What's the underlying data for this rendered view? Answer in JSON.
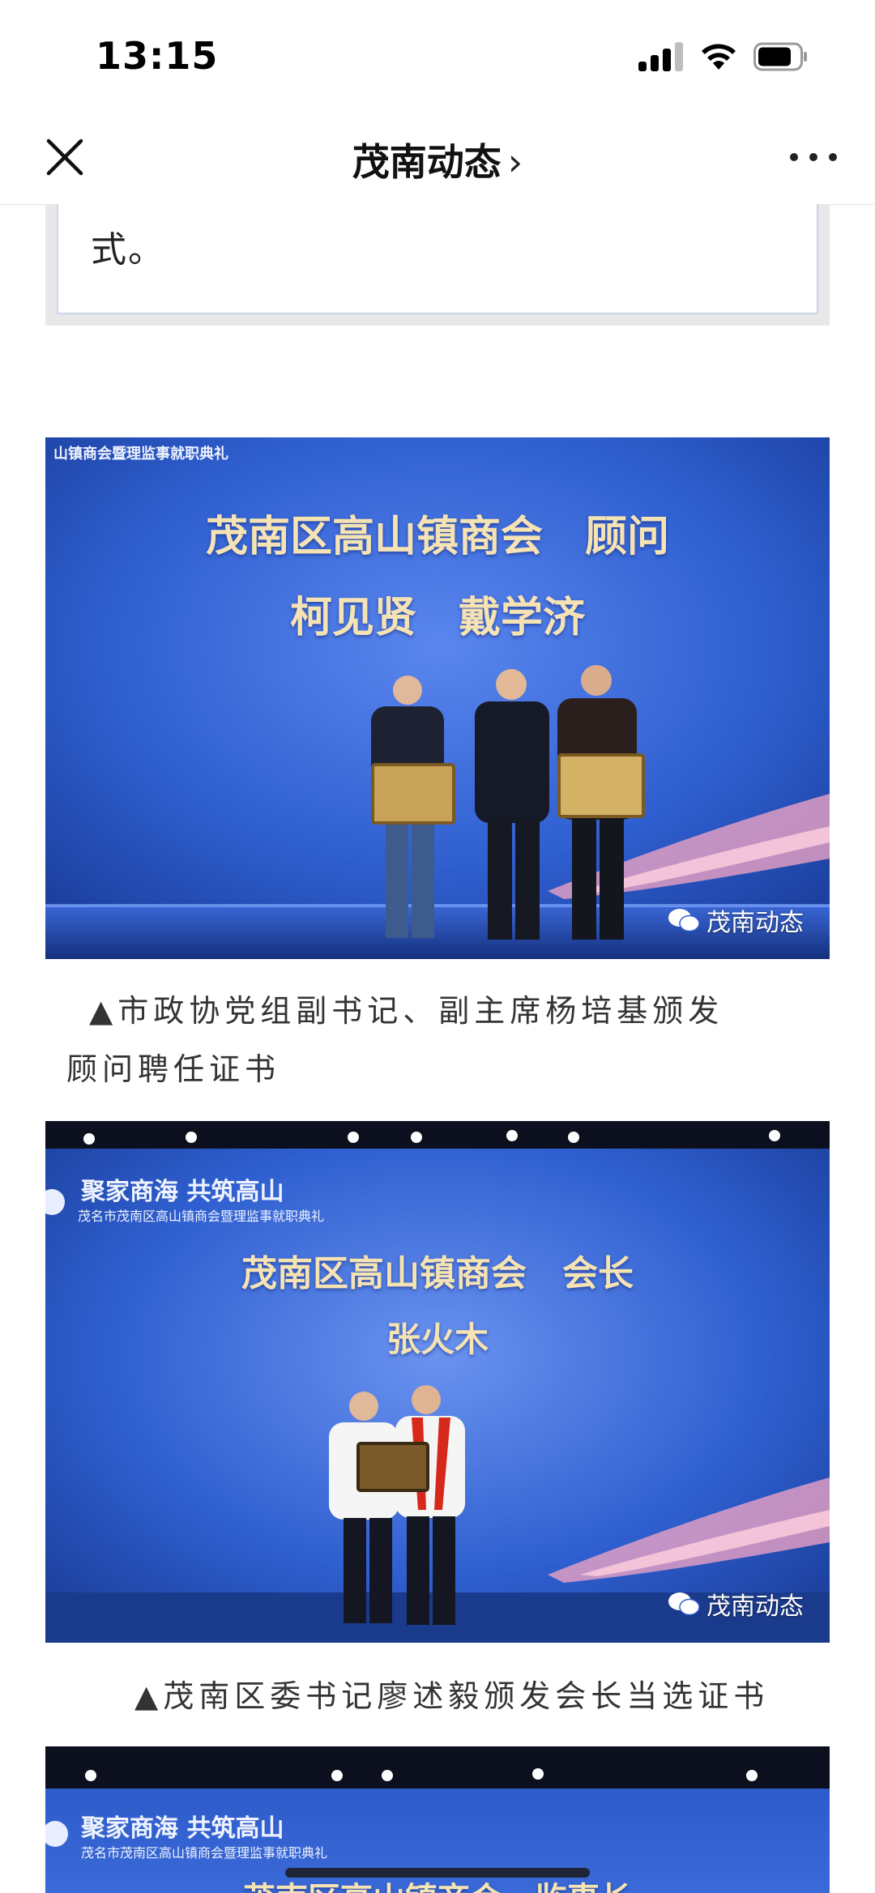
{
  "status_bar": {
    "time": "13:15"
  },
  "nav": {
    "title": "茂南动态",
    "chevron": "›"
  },
  "article": {
    "quote_tail": "式。",
    "photos": [
      {
        "banner_small": "山镇商会暨理监事就职典礼",
        "title": "茂南区高山镇商会　顾问",
        "names": "柯见贤　戴学济",
        "watermark": "茂南动态"
      },
      {
        "banner_logo": "聚家商海 共筑高山",
        "banner_small": "茂名市茂南区高山镇商会暨理监事就职典礼",
        "title": "茂南区高山镇商会　会长",
        "names": "张火木",
        "watermark": "茂南动态"
      },
      {
        "banner_logo": "聚家商海 共筑高山",
        "banner_small": "茂名市茂南区高山镇商会暨理监事就职典礼",
        "title_partial": "茂南区高山镇商会　监事长"
      }
    ],
    "captions": [
      "▲市政协党组副书记、副主席杨培基颁发",
      "顾问聘任证书",
      "▲茂南区委书记廖述毅颁发会长当选证书"
    ]
  },
  "colors": {
    "stage_blue": "#2f5fd0",
    "text": "#333333",
    "border": "#c9d6ea"
  },
  "icons": [
    "signal-icon",
    "wifi-icon",
    "battery-icon",
    "close-icon",
    "chevron-right-icon",
    "more-icon",
    "wechat-icon"
  ]
}
